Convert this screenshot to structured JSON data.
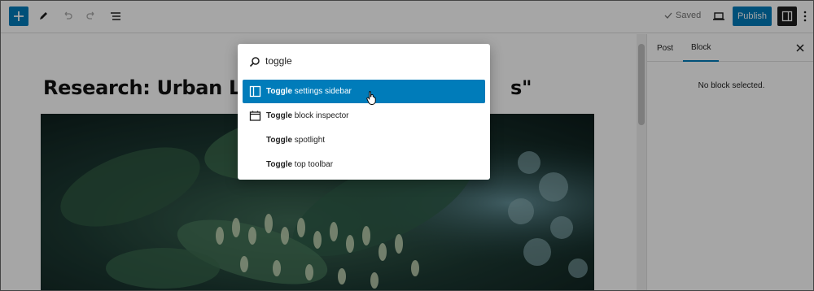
{
  "toolbar": {
    "add_icon": "plus-icon",
    "tools_icon": "pencil-icon",
    "undo_icon": "undo-icon",
    "redo_icon": "redo-icon",
    "list_view_icon": "list-view-icon",
    "saved_label": "Saved",
    "preview_icon": "laptop-icon",
    "publish_label": "Publish",
    "settings_icon": "sidebar-toggle-icon",
    "options_icon": "kebab-icon"
  },
  "editor": {
    "title_left": "Research: Urban Lif",
    "title_right": "s\""
  },
  "sidebar": {
    "tabs": [
      {
        "label": "Post"
      },
      {
        "label": "Block"
      }
    ],
    "empty_message": "No block selected."
  },
  "command_palette": {
    "search_value": "toggle",
    "commands": [
      {
        "bold": "Toggle",
        "rest": " settings sidebar",
        "icon": "sidebar-icon",
        "selected": true
      },
      {
        "bold": "Toggle",
        "rest": " block inspector",
        "icon": "calendar-icon",
        "selected": false
      },
      {
        "bold": "Toggle",
        "rest": " spotlight",
        "icon": "",
        "selected": false
      },
      {
        "bold": "Toggle",
        "rest": " top toolbar",
        "icon": "",
        "selected": false
      }
    ]
  },
  "colors": {
    "accent": "#007cba",
    "dark": "#1e1e1e"
  }
}
